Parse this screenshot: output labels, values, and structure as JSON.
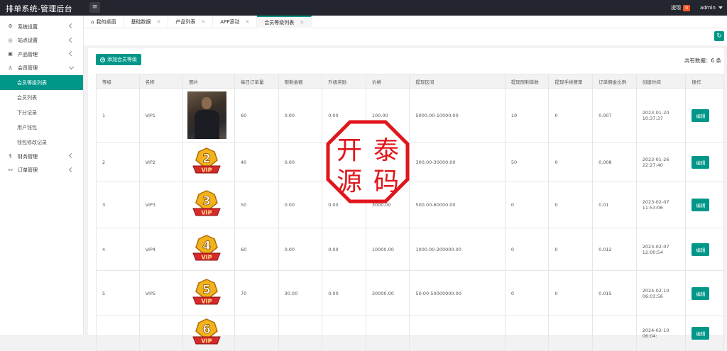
{
  "header": {
    "logo": "排单系统-管理后台",
    "withdraw_label": "提现",
    "withdraw_count": "0",
    "user": "admin"
  },
  "sidebar": {
    "items": [
      {
        "label": "系统设置",
        "icon": "gear-icon"
      },
      {
        "label": "站点设置",
        "icon": "globe-icon"
      },
      {
        "label": "产品管理",
        "icon": "box-icon"
      },
      {
        "label": "会员管理",
        "icon": "user-icon"
      }
    ],
    "sub_items": [
      "会员等级列表",
      "会员列表",
      "下分记录",
      "用户钱包",
      "钱包修改记录"
    ],
    "items_after": [
      {
        "label": "财务管理",
        "icon": "dollar-icon"
      },
      {
        "label": "订单管理",
        "icon": "link-icon"
      }
    ]
  },
  "tabs": [
    {
      "label": "我的桌面",
      "icon": "home-icon"
    },
    {
      "label": "基础数据"
    },
    {
      "label": "产品列表"
    },
    {
      "label": "APP滚动"
    },
    {
      "label": "会员等级列表"
    }
  ],
  "toolbar": {
    "add_label": "添加会员等级",
    "total_label": "共有数据：6 条"
  },
  "table": {
    "headers": [
      "等级",
      "名称",
      "图片",
      "每日订单量",
      "限制金额",
      "升级奖励",
      "价格",
      "提现区间",
      "提现限制单数",
      "提现手续费率",
      "订单佣金比例",
      "创建时间",
      "操作"
    ],
    "edit_label": "编辑",
    "rows": [
      {
        "level": "1",
        "name": "VIP1",
        "image": "photo",
        "daily": "60",
        "limit": "0.00",
        "reward": "0.00",
        "price": "100.00",
        "range": "5000.00-10000.00",
        "wlimit": "10",
        "fee": "0",
        "commission": "0.007",
        "created": "2023-01-20 10:37:37"
      },
      {
        "level": "2",
        "name": "VIP2",
        "image": "2",
        "daily": "40",
        "limit": "0.00",
        "reward": "0.00",
        "price": "",
        "range": "300.00-30000.00",
        "wlimit": "50",
        "fee": "0",
        "commission": "0.008",
        "created": "2023-01-26 22:27:40"
      },
      {
        "level": "3",
        "name": "VIP3",
        "image": "3",
        "daily": "50",
        "limit": "0.00",
        "reward": "0.00",
        "price": "3000.00",
        "range": "500.00-60000.00",
        "wlimit": "0",
        "fee": "0",
        "commission": "0.01",
        "created": "2023-02-07 11:53:06"
      },
      {
        "level": "4",
        "name": "VIP4",
        "image": "4",
        "daily": "60",
        "limit": "0.00",
        "reward": "0.00",
        "price": "10000.00",
        "range": "1000.00-200000.00",
        "wlimit": "0",
        "fee": "0",
        "commission": "0.012",
        "created": "2023-02-07 12:00:54"
      },
      {
        "level": "5",
        "name": "VIP5",
        "image": "5",
        "daily": "70",
        "limit": "30.00",
        "reward": "0.00",
        "price": "30000.00",
        "range": "50.00-50000000.00",
        "wlimit": "0",
        "fee": "0",
        "commission": "0.015",
        "created": "2024-02-10 06:03:56"
      },
      {
        "level": "",
        "name": "",
        "image": "6",
        "daily": "",
        "limit": "",
        "reward": "",
        "price": "",
        "range": "",
        "wlimit": "",
        "fee": "",
        "commission": "",
        "created": "2024-02-10 06:04:"
      }
    ]
  },
  "watermark": {
    "chars": [
      "开",
      "泰",
      "源",
      "码"
    ],
    "color": "#e0161c"
  },
  "colors": {
    "accent": "#009688",
    "topbar": "#23262e",
    "badge": "#ff5722"
  }
}
